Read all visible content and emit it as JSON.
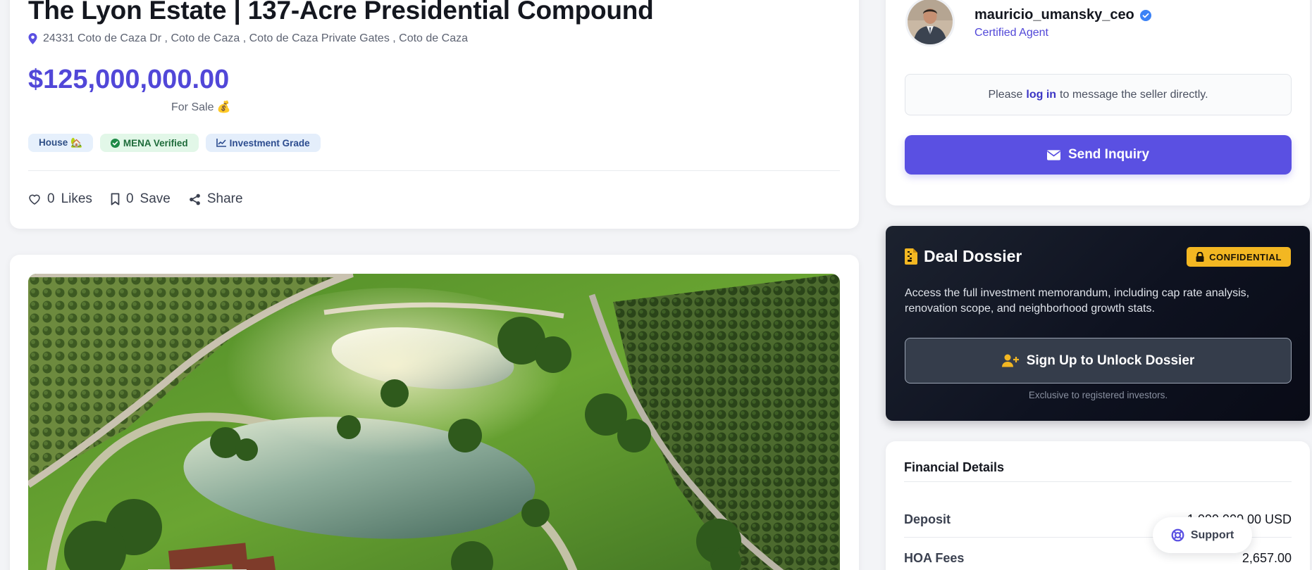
{
  "listing": {
    "title": "The Lyon Estate | 137-Acre Presidential Compound",
    "address": "24331 Coto de Caza Dr , Coto de Caza , Coto de Caza Private Gates , Coto de Caza",
    "price": "$125,000,000.00",
    "status": "For Sale 💰",
    "tags": {
      "house": "House 🏡",
      "mena": "MENA Verified",
      "investment": "Investment Grade"
    },
    "actions": {
      "likes_count": "0",
      "likes_label": "Likes",
      "save_count": "0",
      "save_label": "Save",
      "share_label": "Share"
    },
    "icons": [
      "location-pin-icon",
      "heart-icon",
      "bookmark-icon",
      "share-icon"
    ]
  },
  "agent": {
    "username": "mauricio_umansky_ceo",
    "role": "Certified Agent",
    "login_prefix": "Please",
    "login_link": "log in",
    "login_suffix": "to message the seller directly.",
    "inquiry_button": "Send Inquiry"
  },
  "dossier": {
    "title": "Deal Dossier",
    "badge": "CONFIDENTIAL",
    "description": "Access the full investment memorandum, including cap rate analysis, renovation scope, and neighborhood growth stats.",
    "unlock_button": "Sign Up to Unlock Dossier",
    "note": "Exclusive to registered investors."
  },
  "financial": {
    "title": "Financial Details",
    "rows": [
      {
        "label": "Deposit",
        "value": "1,000,000.00 USD"
      },
      {
        "label": "HOA Fees",
        "value": "2,657.00"
      }
    ]
  },
  "support": {
    "label": "Support"
  },
  "colors": {
    "accent": "#5a50e2",
    "price": "#5147d8",
    "badge_gold": "#f3b722",
    "dossier_bg": "#0e1220"
  }
}
